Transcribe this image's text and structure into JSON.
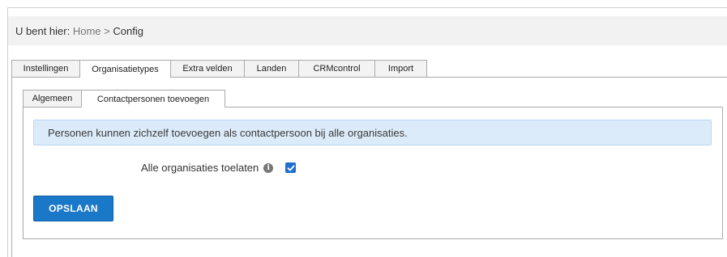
{
  "breadcrumb": {
    "prefix": "U bent hier:",
    "home": "Home",
    "separator": ">",
    "current": "Config"
  },
  "tabs": [
    {
      "label": "Instellingen",
      "active": false
    },
    {
      "label": "Organisatietypes",
      "active": true
    },
    {
      "label": "Extra velden",
      "active": false
    },
    {
      "label": "Landen",
      "active": false
    },
    {
      "label": "CRMcontrol",
      "active": false
    },
    {
      "label": "Import",
      "active": false
    }
  ],
  "subtabs": [
    {
      "label": "Algemeen",
      "active": false
    },
    {
      "label": "Contactpersonen toevoegen",
      "active": true
    }
  ],
  "info_message": "Personen kunnen zichzelf toevoegen als contactpersoon bij alle organisaties.",
  "field": {
    "label": "Alle organisaties toelaten",
    "info_icon": "info-circle-icon",
    "checked": true
  },
  "save_button": "OPSLAAN",
  "colors": {
    "accent": "#1a78c9",
    "info_bg": "#dcebf9",
    "checkbox": "#1f6fd1"
  }
}
